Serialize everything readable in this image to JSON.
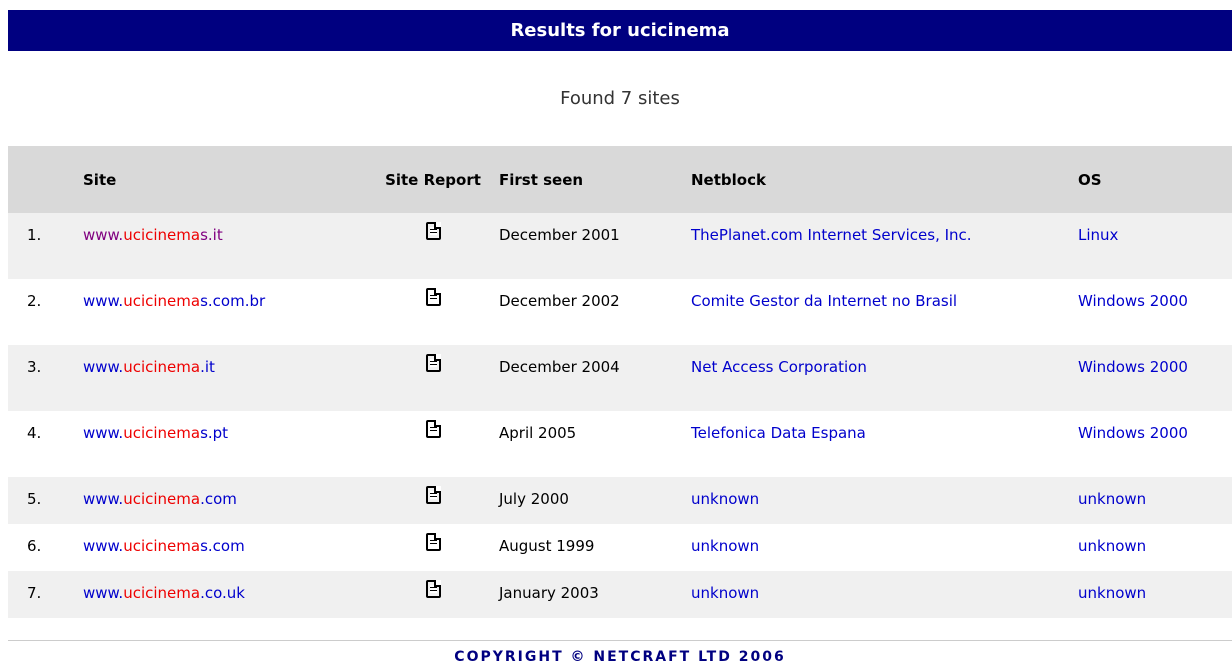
{
  "title_prefix": "Results for ",
  "title_query": "ucicinema",
  "found_text": "Found 7 sites",
  "columns": {
    "num": "",
    "site": "Site",
    "report": "Site Report",
    "first_seen": "First seen",
    "netblock": "Netblock",
    "os": "OS"
  },
  "rows": [
    {
      "num": "1.",
      "site_pre": "www.",
      "site_hi": "ucicinema",
      "site_post": "s.it",
      "visited": true,
      "first_seen": "December 2001",
      "netblock": "ThePlanet.com Internet Services, Inc.",
      "os": "Linux"
    },
    {
      "num": "2.",
      "site_pre": "www.",
      "site_hi": "ucicinema",
      "site_post": "s.com.br",
      "visited": false,
      "first_seen": "December 2002",
      "netblock": "Comite Gestor da Internet no Brasil",
      "os": "Windows 2000"
    },
    {
      "num": "3.",
      "site_pre": "www.",
      "site_hi": "ucicinema",
      "site_post": ".it",
      "visited": false,
      "first_seen": "December 2004",
      "netblock": "Net Access Corporation",
      "os": "Windows 2000"
    },
    {
      "num": "4.",
      "site_pre": "www.",
      "site_hi": "ucicinema",
      "site_post": "s.pt",
      "visited": false,
      "first_seen": "April 2005",
      "netblock": "Telefonica Data Espana",
      "os": "Windows 2000"
    },
    {
      "num": "5.",
      "site_pre": "www.",
      "site_hi": "ucicinema",
      "site_post": ".com",
      "visited": false,
      "first_seen": "July 2000",
      "netblock": "unknown",
      "os": "unknown"
    },
    {
      "num": "6.",
      "site_pre": "www.",
      "site_hi": "ucicinema",
      "site_post": "s.com",
      "visited": false,
      "first_seen": "August 1999",
      "netblock": "unknown",
      "os": "unknown"
    },
    {
      "num": "7.",
      "site_pre": "www.",
      "site_hi": "ucicinema",
      "site_post": ".co.uk",
      "visited": false,
      "first_seen": "January 2003",
      "netblock": "unknown",
      "os": "unknown"
    }
  ],
  "footer": "COPYRIGHT © NETCRAFT LTD 2006",
  "colors": {
    "title_bar": "#000080",
    "link": "#0000cc",
    "query_highlight": "#ee0000",
    "visited_link": "#800080",
    "header_bg": "#d9d9d9",
    "row_alt_bg": "#f0f0f0"
  },
  "icons": {
    "site_report": "document-icon"
  }
}
